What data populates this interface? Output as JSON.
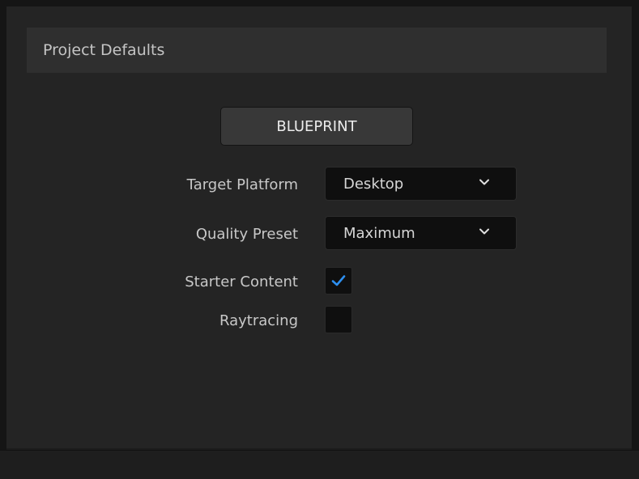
{
  "panel": {
    "section_title": "Project Defaults"
  },
  "template_button": {
    "label": "BLUEPRINT"
  },
  "fields": {
    "target_platform": {
      "label": "Target Platform",
      "value": "Desktop"
    },
    "quality_preset": {
      "label": "Quality Preset",
      "value": "Maximum"
    },
    "starter_content": {
      "label": "Starter Content",
      "checked": true
    },
    "raytracing": {
      "label": "Raytracing",
      "checked": false
    }
  },
  "icons": {
    "dropdown": "chevron-down-icon",
    "check": "checkmark-icon"
  },
  "colors": {
    "checkmark": "#2d8ff0",
    "panel_background": "#242424",
    "header_background": "#2f2f2f",
    "button_background": "#383838",
    "field_background": "#0f0f0f"
  }
}
